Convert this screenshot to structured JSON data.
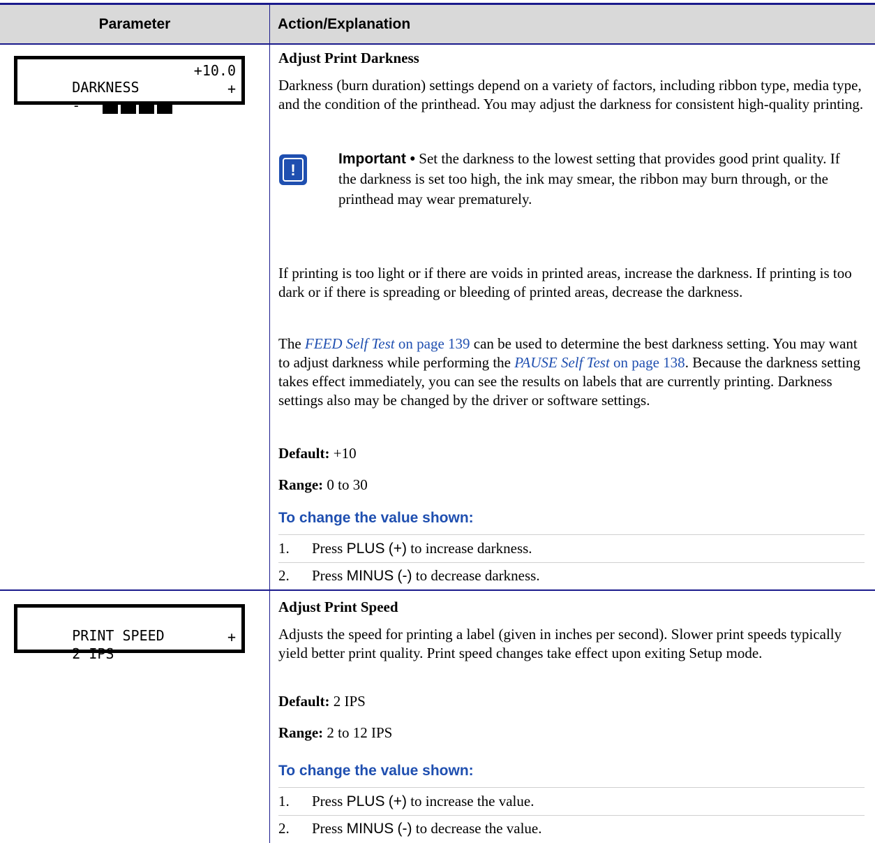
{
  "header": {
    "parameter": "Parameter",
    "action": "Action/Explanation"
  },
  "rows": [
    {
      "lcd": {
        "line1_left": "DARKNESS",
        "line1_right": "+10.0",
        "line2_left": "-",
        "line2_right": "+",
        "bar_blocks": 4
      },
      "title": "Adjust Print Darkness",
      "intro": "Darkness (burn duration) settings depend on a variety of factors, including ribbon type, media type, and the condition of the printhead. You may adjust the darkness for consistent high-quality printing.",
      "important_label": "Important •",
      "important_text": " Set the darkness to the lowest setting that provides good print quality. If the darkness is set too high, the ink may smear, the ribbon may burn through, or the printhead may wear prematurely.",
      "para2": "If printing is too light or if there are voids in printed areas, increase the darkness. If printing is too dark or if there is spreading or bleeding of printed areas, decrease the darkness.",
      "para3_a": "The ",
      "link1_italic": "FEED Self Test",
      "link1_page": " on page 139",
      "para3_b": " can be used to determine the best darkness setting. You may want to adjust darkness while performing the ",
      "link2_italic": "PAUSE Self Test",
      "link2_page": " on page 138",
      "para3_c": ". Because the darkness setting takes effect immediately, you can see the results on labels that are currently printing. Darkness settings also may be changed by the driver or software settings.",
      "default_label": "Default:",
      "default_value": " +10",
      "range_label": "Range:",
      "range_value": " 0 to 30",
      "subheading": "To change the value shown:",
      "steps": [
        {
          "num": "1.",
          "pre": "Press ",
          "key": "PLUS",
          "sym": "(+)",
          "post": " to increase darkness."
        },
        {
          "num": "2.",
          "pre": "Press ",
          "key": "MINUS",
          "sym": "(-)",
          "post": " to decrease darkness."
        }
      ]
    },
    {
      "lcd": {
        "line1_left": "PRINT SPEED",
        "line1_right": "",
        "line2_left": "2 IPS",
        "line2_right": "+"
      },
      "title": "Adjust Print Speed",
      "intro": "Adjusts the speed for printing a label (given in inches per second). Slower print speeds typically yield better print quality. Print speed changes take effect upon exiting Setup mode.",
      "default_label": "Default:",
      "default_value": " 2 IPS",
      "range_label": "Range:",
      "range_value": " 2 to 12 IPS",
      "subheading": "To change the value shown:",
      "steps": [
        {
          "num": "1.",
          "pre": "Press ",
          "key": "PLUS",
          "sym": "(+)",
          "post": " to increase the value."
        },
        {
          "num": "2.",
          "pre": "Press ",
          "key": "MINUS",
          "sym": "(-)",
          "post": " to decrease the value."
        }
      ]
    }
  ],
  "colors": {
    "rule": "#1a1a8c",
    "link": "#1f4fb0",
    "header_bg": "#d9d9d9"
  }
}
